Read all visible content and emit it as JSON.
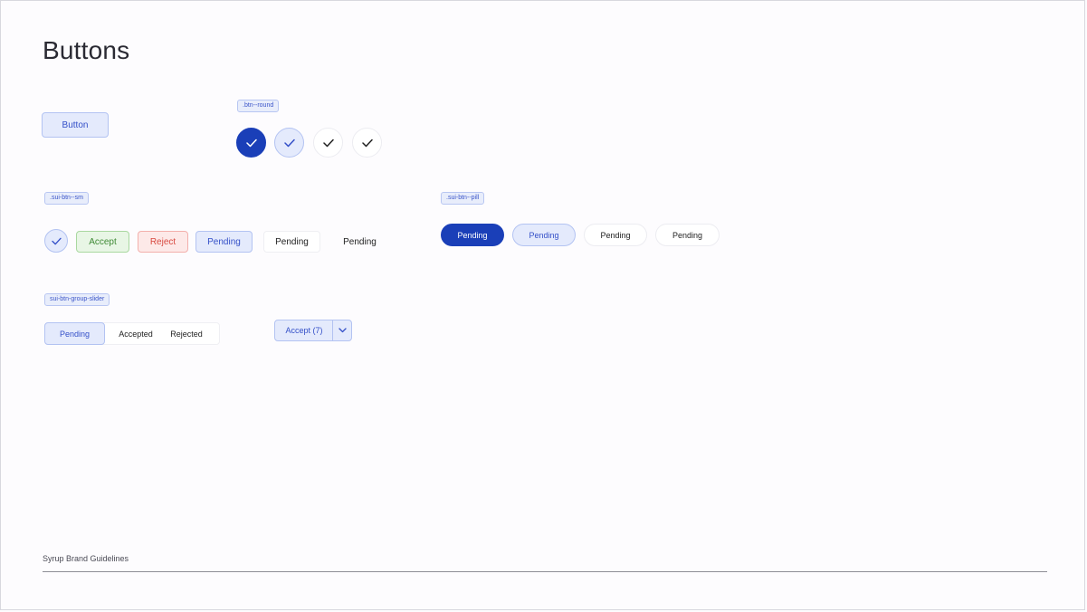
{
  "page": {
    "title": "Buttons"
  },
  "default_button": {
    "label": "Button"
  },
  "round_section": {
    "tag": ".btn--round",
    "buttons": [
      {
        "variant": "solid",
        "icon": "check-icon"
      },
      {
        "variant": "light",
        "icon": "check-icon"
      },
      {
        "variant": "white",
        "icon": "check-icon"
      },
      {
        "variant": "white",
        "icon": "check-icon"
      }
    ]
  },
  "sm_section": {
    "tag": ".sui-btn--sm",
    "buttons": [
      {
        "label": "",
        "icon": "check-icon"
      },
      {
        "label": "Accept"
      },
      {
        "label": "Reject"
      },
      {
        "label": "Pending"
      },
      {
        "label": "Pending"
      },
      {
        "label": "Pending"
      }
    ]
  },
  "pill_section": {
    "tag": ".sui-btn--pill",
    "buttons": [
      {
        "label": "Pending"
      },
      {
        "label": "Pending"
      },
      {
        "label": "Pending"
      },
      {
        "label": "Pending"
      }
    ]
  },
  "slider_section": {
    "tag": "sui-btn-group-slider",
    "segments": [
      {
        "label": "Pending",
        "active": true
      },
      {
        "label": "Accepted",
        "active": false
      },
      {
        "label": "Rejected",
        "active": false
      }
    ]
  },
  "split_button": {
    "label": "Accept (7)",
    "caret_icon": "chevron-down-icon"
  },
  "footer": {
    "text": "Syrup Brand Guidelines"
  },
  "colors": {
    "brand_blue": "#1a3fb8",
    "light_blue_bg": "#e4eafc",
    "accept_green": "#3f8a35",
    "reject_red": "#d8483f"
  }
}
